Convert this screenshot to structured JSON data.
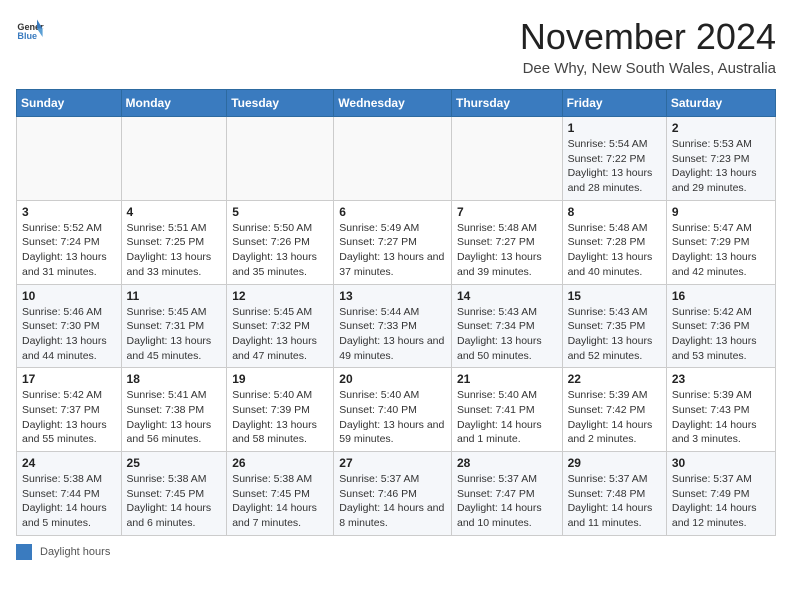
{
  "header": {
    "logo_general": "General",
    "logo_blue": "Blue",
    "month": "November 2024",
    "location": "Dee Why, New South Wales, Australia"
  },
  "weekdays": [
    "Sunday",
    "Monday",
    "Tuesday",
    "Wednesday",
    "Thursday",
    "Friday",
    "Saturday"
  ],
  "weeks": [
    [
      {
        "day": "",
        "info": ""
      },
      {
        "day": "",
        "info": ""
      },
      {
        "day": "",
        "info": ""
      },
      {
        "day": "",
        "info": ""
      },
      {
        "day": "",
        "info": ""
      },
      {
        "day": "1",
        "info": "Sunrise: 5:54 AM\nSunset: 7:22 PM\nDaylight: 13 hours and 28 minutes."
      },
      {
        "day": "2",
        "info": "Sunrise: 5:53 AM\nSunset: 7:23 PM\nDaylight: 13 hours and 29 minutes."
      }
    ],
    [
      {
        "day": "3",
        "info": "Sunrise: 5:52 AM\nSunset: 7:24 PM\nDaylight: 13 hours and 31 minutes."
      },
      {
        "day": "4",
        "info": "Sunrise: 5:51 AM\nSunset: 7:25 PM\nDaylight: 13 hours and 33 minutes."
      },
      {
        "day": "5",
        "info": "Sunrise: 5:50 AM\nSunset: 7:26 PM\nDaylight: 13 hours and 35 minutes."
      },
      {
        "day": "6",
        "info": "Sunrise: 5:49 AM\nSunset: 7:27 PM\nDaylight: 13 hours and 37 minutes."
      },
      {
        "day": "7",
        "info": "Sunrise: 5:48 AM\nSunset: 7:27 PM\nDaylight: 13 hours and 39 minutes."
      },
      {
        "day": "8",
        "info": "Sunrise: 5:48 AM\nSunset: 7:28 PM\nDaylight: 13 hours and 40 minutes."
      },
      {
        "day": "9",
        "info": "Sunrise: 5:47 AM\nSunset: 7:29 PM\nDaylight: 13 hours and 42 minutes."
      }
    ],
    [
      {
        "day": "10",
        "info": "Sunrise: 5:46 AM\nSunset: 7:30 PM\nDaylight: 13 hours and 44 minutes."
      },
      {
        "day": "11",
        "info": "Sunrise: 5:45 AM\nSunset: 7:31 PM\nDaylight: 13 hours and 45 minutes."
      },
      {
        "day": "12",
        "info": "Sunrise: 5:45 AM\nSunset: 7:32 PM\nDaylight: 13 hours and 47 minutes."
      },
      {
        "day": "13",
        "info": "Sunrise: 5:44 AM\nSunset: 7:33 PM\nDaylight: 13 hours and 49 minutes."
      },
      {
        "day": "14",
        "info": "Sunrise: 5:43 AM\nSunset: 7:34 PM\nDaylight: 13 hours and 50 minutes."
      },
      {
        "day": "15",
        "info": "Sunrise: 5:43 AM\nSunset: 7:35 PM\nDaylight: 13 hours and 52 minutes."
      },
      {
        "day": "16",
        "info": "Sunrise: 5:42 AM\nSunset: 7:36 PM\nDaylight: 13 hours and 53 minutes."
      }
    ],
    [
      {
        "day": "17",
        "info": "Sunrise: 5:42 AM\nSunset: 7:37 PM\nDaylight: 13 hours and 55 minutes."
      },
      {
        "day": "18",
        "info": "Sunrise: 5:41 AM\nSunset: 7:38 PM\nDaylight: 13 hours and 56 minutes."
      },
      {
        "day": "19",
        "info": "Sunrise: 5:40 AM\nSunset: 7:39 PM\nDaylight: 13 hours and 58 minutes."
      },
      {
        "day": "20",
        "info": "Sunrise: 5:40 AM\nSunset: 7:40 PM\nDaylight: 13 hours and 59 minutes."
      },
      {
        "day": "21",
        "info": "Sunrise: 5:40 AM\nSunset: 7:41 PM\nDaylight: 14 hours and 1 minute."
      },
      {
        "day": "22",
        "info": "Sunrise: 5:39 AM\nSunset: 7:42 PM\nDaylight: 14 hours and 2 minutes."
      },
      {
        "day": "23",
        "info": "Sunrise: 5:39 AM\nSunset: 7:43 PM\nDaylight: 14 hours and 3 minutes."
      }
    ],
    [
      {
        "day": "24",
        "info": "Sunrise: 5:38 AM\nSunset: 7:44 PM\nDaylight: 14 hours and 5 minutes."
      },
      {
        "day": "25",
        "info": "Sunrise: 5:38 AM\nSunset: 7:45 PM\nDaylight: 14 hours and 6 minutes."
      },
      {
        "day": "26",
        "info": "Sunrise: 5:38 AM\nSunset: 7:45 PM\nDaylight: 14 hours and 7 minutes."
      },
      {
        "day": "27",
        "info": "Sunrise: 5:37 AM\nSunset: 7:46 PM\nDaylight: 14 hours and 8 minutes."
      },
      {
        "day": "28",
        "info": "Sunrise: 5:37 AM\nSunset: 7:47 PM\nDaylight: 14 hours and 10 minutes."
      },
      {
        "day": "29",
        "info": "Sunrise: 5:37 AM\nSunset: 7:48 PM\nDaylight: 14 hours and 11 minutes."
      },
      {
        "day": "30",
        "info": "Sunrise: 5:37 AM\nSunset: 7:49 PM\nDaylight: 14 hours and 12 minutes."
      }
    ]
  ],
  "footer": {
    "daylight_label": "Daylight hours"
  }
}
